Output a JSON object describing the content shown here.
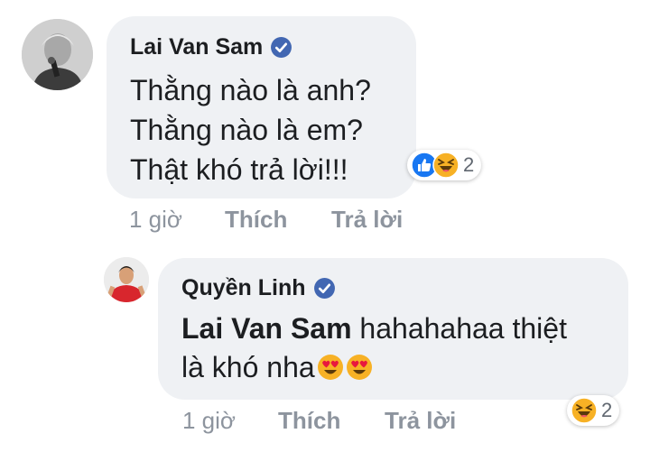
{
  "comments": [
    {
      "author": "Lai Van Sam",
      "lines": [
        "Thằng nào là anh?",
        "Thằng nào là em?",
        "Thật khó trả lời!!!"
      ],
      "reaction_count": "2",
      "time": "1 giờ",
      "like_label": "Thích",
      "reply_label": "Trả lời"
    },
    {
      "author": "Quyền Linh",
      "mention": "Lai Van Sam",
      "text_after_mention": " hahahahaa thiệt",
      "line2": "là khó nha",
      "reaction_count": "2",
      "time": "1 giờ",
      "like_label": "Thích",
      "reply_label": "Trả lời"
    }
  ],
  "colors": {
    "bubble": "#eff1f4",
    "text": "#1c1e21",
    "meta": "#8d949e",
    "verified": "#4267b2",
    "like": "#1877f2",
    "haha": "#f7b125"
  }
}
